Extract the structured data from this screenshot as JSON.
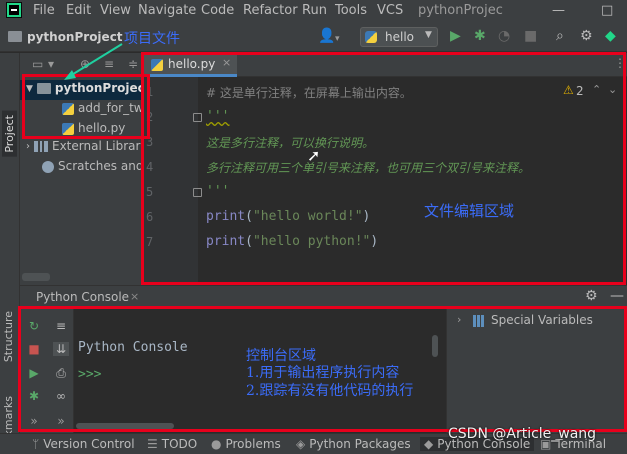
{
  "menubar": {
    "items": [
      "File",
      "Edit",
      "View",
      "Navigate",
      "Code",
      "Refactor",
      "Run",
      "Tools",
      "VCS"
    ],
    "window_title": "pythonProjec",
    "minimize": "—",
    "maximize": "□"
  },
  "navbar": {
    "project_name": "pythonProject",
    "run_config": "hello"
  },
  "left_strip": {
    "project_tab": "Project",
    "structure_tab": "Structure",
    "bookmarks_tab": "Bookmarks"
  },
  "project_tree": {
    "root": "pythonProject",
    "files": [
      "add_for_two",
      "hello.py"
    ],
    "external_libraries": "External Librar",
    "scratches": "Scratches and"
  },
  "editor": {
    "tab_label": "hello.py",
    "tab_close": "×",
    "warning_count": "2",
    "line_numbers": [
      "1",
      "2",
      "3",
      "4",
      "5",
      "6",
      "7"
    ],
    "lines": {
      "l1": "# 这是单行注释，在屏幕上输出内容。",
      "l2": "'''",
      "l3": "这是多行注释，可以换行说明。",
      "l4": "多行注释可用三个单引号来注释，也可用三个双引号来注释。",
      "l5": "'''",
      "l6_fn": "print",
      "l6_open": "(",
      "l6_str": "\"hello world!\"",
      "l6_close": ")",
      "l7_fn": "print",
      "l7_open": "(",
      "l7_str": "\"hello python!\"",
      "l7_close": ")"
    }
  },
  "console": {
    "header_title": "Python Console",
    "header_close": "×",
    "output_title": "Python Console",
    "prompt": ">>>",
    "variables_label": "Special Variables"
  },
  "bottombar": {
    "tabs": [
      "Version Control",
      "TODO",
      "Problems",
      "Python Packages",
      "Python Console",
      "Terminal"
    ]
  },
  "annotations": {
    "project_area": "项目文件",
    "editor_area": "文件编辑区域",
    "console_title": "控制台区域",
    "console_line1": "1.用于输出程序执行内容",
    "console_line2": "2.跟踪有没有他代码的执行"
  },
  "watermark": "CSDN @Article_wang",
  "colors": {
    "annotation_red": "#e8001c",
    "annotation_blue": "#3b6cf8",
    "docstring_green": "#629755",
    "string_green": "#6a8759",
    "builtin_purple": "#8888c6",
    "run_green": "#59a869"
  }
}
